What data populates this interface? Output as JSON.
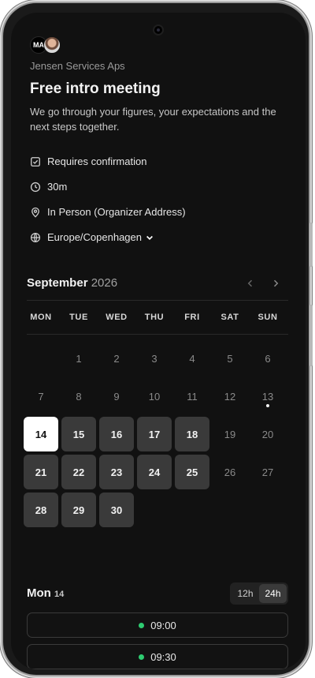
{
  "organizer": {
    "initials": "MA",
    "company": "Jensen Services Aps"
  },
  "event": {
    "title": "Free intro meeting",
    "description": "We go through your figures, your expectations and the next steps together.",
    "confirmation": "Requires confirmation",
    "duration": "30m",
    "location": "In Person (Organizer Address)",
    "timezone": "Europe/Copenhagen"
  },
  "calendar": {
    "month": "September",
    "year": "2026",
    "weekdays": [
      "MON",
      "TUE",
      "WED",
      "THU",
      "FRI",
      "SAT",
      "SUN"
    ],
    "weeks": [
      [
        "",
        "1",
        "2",
        "3",
        "4",
        "5",
        "6"
      ],
      [
        "7",
        "8",
        "9",
        "10",
        "11",
        "12",
        "13"
      ],
      [
        "14",
        "15",
        "16",
        "17",
        "18",
        "19",
        "20"
      ],
      [
        "21",
        "22",
        "23",
        "24",
        "25",
        "26",
        "27"
      ],
      [
        "28",
        "29",
        "30",
        "",
        "",
        "",
        ""
      ]
    ],
    "available_days": [
      "15",
      "16",
      "17",
      "18",
      "21",
      "22",
      "23",
      "24",
      "25",
      "28",
      "29",
      "30"
    ],
    "selected_day": "14",
    "today_day": "13"
  },
  "selected": {
    "weekday": "Mon",
    "day": "14"
  },
  "time_format": {
    "options": [
      "12h",
      "24h"
    ],
    "active": "24h"
  },
  "slots": [
    "09:00",
    "09:30"
  ]
}
